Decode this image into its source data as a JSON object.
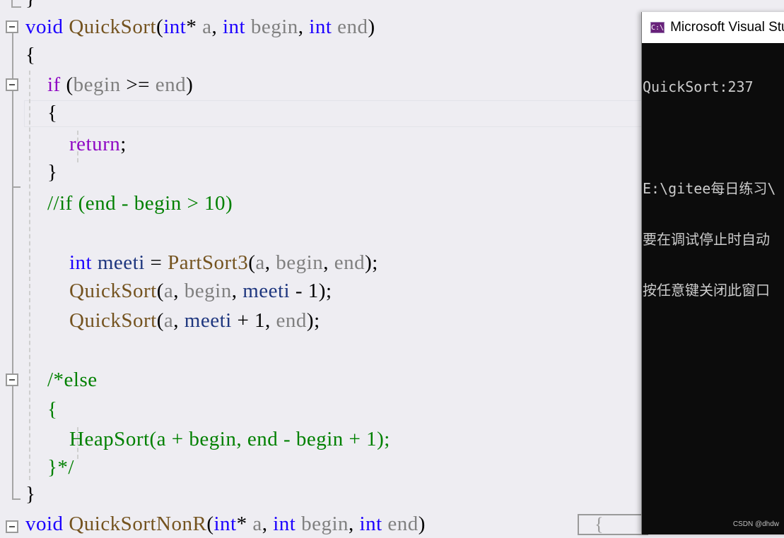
{
  "editor": {
    "lines": [
      {
        "row": "prev",
        "tokens": [
          {
            "t": "}",
            "c": "pun"
          }
        ]
      },
      {
        "row": "sig",
        "tokens": [
          {
            "t": "void",
            "c": "kw"
          },
          {
            "t": " "
          },
          {
            "t": "QuickSort",
            "c": "fn"
          },
          {
            "t": "(",
            "c": "pun"
          },
          {
            "t": "int",
            "c": "kw"
          },
          {
            "t": "* ",
            "c": "pun"
          },
          {
            "t": "a",
            "c": "par"
          },
          {
            "t": ", ",
            "c": "pun"
          },
          {
            "t": "int",
            "c": "kw"
          },
          {
            "t": " "
          },
          {
            "t": "begin",
            "c": "par"
          },
          {
            "t": ", ",
            "c": "pun"
          },
          {
            "t": "int",
            "c": "kw"
          },
          {
            "t": " "
          },
          {
            "t": "end",
            "c": "par"
          },
          {
            "t": ")",
            "c": "pun"
          }
        ]
      },
      {
        "row": "open",
        "tokens": [
          {
            "t": "{",
            "c": "pun"
          }
        ]
      },
      {
        "row": "if",
        "tokens": [
          {
            "t": "    "
          },
          {
            "t": "if",
            "c": "ctl"
          },
          {
            "t": " (",
            "c": "pun"
          },
          {
            "t": "begin",
            "c": "par"
          },
          {
            "t": " >= ",
            "c": "pun"
          },
          {
            "t": "end",
            "c": "par"
          },
          {
            "t": ")",
            "c": "pun"
          }
        ]
      },
      {
        "row": "if-open",
        "tokens": [
          {
            "t": "    {",
            "c": "pun"
          }
        ]
      },
      {
        "row": "return",
        "tokens": [
          {
            "t": "        "
          },
          {
            "t": "return",
            "c": "ctl"
          },
          {
            "t": ";",
            "c": "pun"
          }
        ]
      },
      {
        "row": "if-close",
        "tokens": [
          {
            "t": "    }",
            "c": "pun"
          }
        ]
      },
      {
        "row": "comment-if",
        "tokens": [
          {
            "t": "    "
          },
          {
            "t": "//if (end - begin > 10)",
            "c": "cm"
          }
        ]
      },
      {
        "row": "blank1",
        "tokens": []
      },
      {
        "row": "meeti",
        "tokens": [
          {
            "t": "        "
          },
          {
            "t": "int",
            "c": "kw"
          },
          {
            "t": " "
          },
          {
            "t": "meeti",
            "c": "loc"
          },
          {
            "t": " = ",
            "c": "pun"
          },
          {
            "t": "PartSort3",
            "c": "fn"
          },
          {
            "t": "(",
            "c": "pun"
          },
          {
            "t": "a",
            "c": "par"
          },
          {
            "t": ", ",
            "c": "pun"
          },
          {
            "t": "begin",
            "c": "par"
          },
          {
            "t": ", ",
            "c": "pun"
          },
          {
            "t": "end",
            "c": "par"
          },
          {
            "t": ");",
            "c": "pun"
          }
        ]
      },
      {
        "row": "rec1",
        "tokens": [
          {
            "t": "        "
          },
          {
            "t": "QuickSort",
            "c": "fn"
          },
          {
            "t": "(",
            "c": "pun"
          },
          {
            "t": "a",
            "c": "par"
          },
          {
            "t": ", ",
            "c": "pun"
          },
          {
            "t": "begin",
            "c": "par"
          },
          {
            "t": ", ",
            "c": "pun"
          },
          {
            "t": "meeti",
            "c": "loc"
          },
          {
            "t": " - 1);",
            "c": "pun"
          }
        ]
      },
      {
        "row": "rec2",
        "tokens": [
          {
            "t": "        "
          },
          {
            "t": "QuickSort",
            "c": "fn"
          },
          {
            "t": "(",
            "c": "pun"
          },
          {
            "t": "a",
            "c": "par"
          },
          {
            "t": ", ",
            "c": "pun"
          },
          {
            "t": "meeti",
            "c": "loc"
          },
          {
            "t": " + 1, ",
            "c": "pun"
          },
          {
            "t": "end",
            "c": "par"
          },
          {
            "t": ");",
            "c": "pun"
          }
        ]
      },
      {
        "row": "blank2",
        "tokens": []
      },
      {
        "row": "else",
        "tokens": [
          {
            "t": "    "
          },
          {
            "t": "/*else",
            "c": "cm"
          }
        ]
      },
      {
        "row": "else-open",
        "tokens": [
          {
            "t": "    "
          },
          {
            "t": "{",
            "c": "cm"
          }
        ]
      },
      {
        "row": "heap",
        "tokens": [
          {
            "t": "        "
          },
          {
            "t": "HeapSort(a + begin, end - begin + 1);",
            "c": "cm"
          }
        ]
      },
      {
        "row": "else-close",
        "tokens": [
          {
            "t": "    "
          },
          {
            "t": "}*/",
            "c": "cm"
          }
        ]
      },
      {
        "row": "close",
        "tokens": [
          {
            "t": "}",
            "c": "pun"
          }
        ]
      },
      {
        "row": "next",
        "tokens": [
          {
            "t": "void",
            "c": "kw"
          },
          {
            "t": " "
          },
          {
            "t": "QuickSortNonR",
            "c": "fn"
          },
          {
            "t": "(",
            "c": "pun"
          },
          {
            "t": "int",
            "c": "kw"
          },
          {
            "t": "* ",
            "c": "pun"
          },
          {
            "t": "a",
            "c": "par"
          },
          {
            "t": ", ",
            "c": "pun"
          },
          {
            "t": "int",
            "c": "kw"
          },
          {
            "t": " "
          },
          {
            "t": "begin",
            "c": "par"
          },
          {
            "t": ", ",
            "c": "pun"
          },
          {
            "t": "int",
            "c": "kw"
          },
          {
            "t": " "
          },
          {
            "t": "end",
            "c": "par"
          },
          {
            "t": ")",
            "c": "pun"
          }
        ]
      }
    ],
    "collapsed_preview": "{"
  },
  "console": {
    "title": "Microsoft Visual Studio Debug Console",
    "icon_label": "C:\\",
    "output": [
      "QuickSort:237",
      "",
      "E:\\gitee每日练习\\",
      "要在调试停止时自动",
      "按任意键关闭此窗口"
    ],
    "watermark": "CSDN @dhdw"
  },
  "colors": {
    "editor_bg": "#eeedf2",
    "keyword": "#1c00ff",
    "control": "#8f08c4",
    "function": "#74531f",
    "parameter": "#808080",
    "local": "#1f377f",
    "comment": "#008000",
    "console_bg": "#0c0c0c",
    "console_text": "#cccccc"
  }
}
